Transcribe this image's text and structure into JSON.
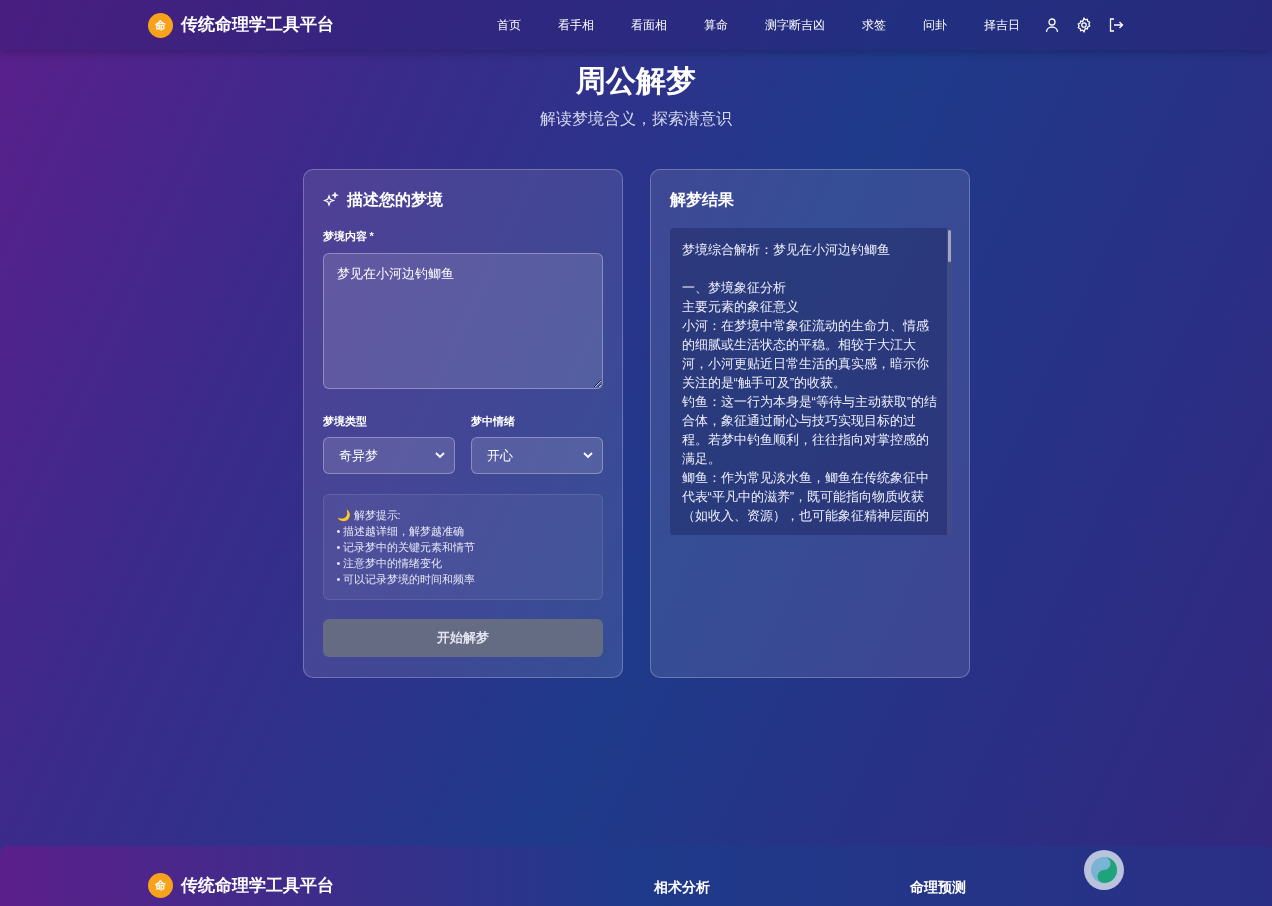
{
  "navbar": {
    "logo_char": "命",
    "brand": "传统命理学工具平台",
    "links": [
      {
        "label": "首页",
        "selected": false
      },
      {
        "label": "看手相",
        "selected": false
      },
      {
        "label": "看面相",
        "selected": false
      },
      {
        "label": "算命",
        "selected": false
      },
      {
        "label": "测字断吉凶",
        "selected": false
      },
      {
        "label": "求签",
        "selected": false
      },
      {
        "label": "问卦",
        "selected": false
      },
      {
        "label": "择吉日",
        "selected": false
      }
    ]
  },
  "page": {
    "title": "周公解梦",
    "subtitle": "解读梦境含义，探索潜意识"
  },
  "form": {
    "title": "描述您的梦境",
    "content_label": "梦境内容 *",
    "content_value": "梦见在小河边钓鲫鱼",
    "type_label": "梦境类型",
    "type_value": "奇异梦",
    "emotion_label": "梦中情绪",
    "emotion_value": "开心",
    "tips": [
      "🌙 解梦提示:",
      "• 描述越详细，解梦越准确",
      "• 记录梦中的关键元素和情节",
      "• 注意梦中的情绪变化",
      "• 可以记录梦境的时间和频率"
    ],
    "submit": {
      "label": "开始解梦",
      "disabled": true
    }
  },
  "result": {
    "title": "解梦结果",
    "heading": "梦境综合解析：梦见在小河边钓鲫鱼",
    "paragraphs": [
      "一、梦境象征分析",
      "主要元素的象征意义",
      "小河：在梦境中常象征流动的生命力、情感的细腻或生活状态的平稳。相较于大江大河，小河更贴近日常生活的真实感，暗示你关注的是“触手可及”的收获。",
      "钓鱼：这一行为本身是“等待与主动获取”的结合体，象征通过耐心与技巧实现目标的过程。若梦中钓鱼顺利，往往指向对掌控感的满足。",
      "鲫鱼：作为常见淡水鱼，鲫鱼在传统象征中代表“平凡中的滋养”，既可能指向物质收获（如收入、资源），也可能象征精神层面的"
    ]
  },
  "footer": {
    "logo_char": "命",
    "brand": "传统命理学工具平台",
    "headings": [
      "相术分析",
      "命理预测"
    ]
  }
}
